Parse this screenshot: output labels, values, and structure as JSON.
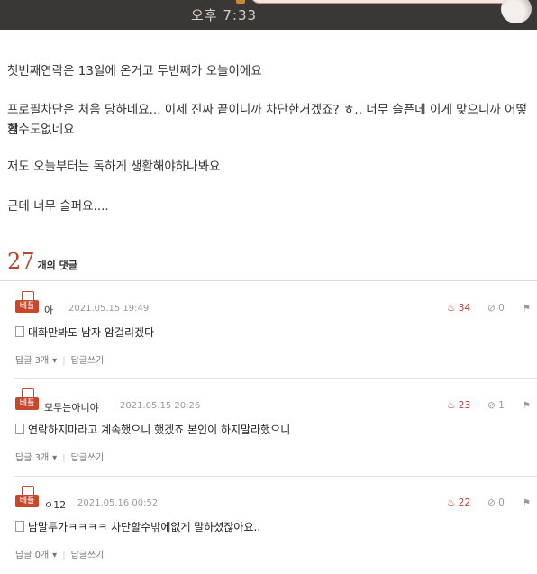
{
  "status": {
    "time": "오후 7:33"
  },
  "post": {
    "lines": [
      "첫번째연락은 13일에 온거고 두번째가 오늘이에요",
      "프로필차단은 처음 당하네요... 이제 진짜 끝이니까 차단한거겠죠? ㅎ.. 너무 슬픈데 이게 맞으니까 어떻게",
      "할수도없네요",
      "저도 오늘부터는 독하게 생활해야하나봐요",
      "근데 너무 슬퍼요...."
    ]
  },
  "comments_header": {
    "count": "27",
    "label": "개의 댓글"
  },
  "comments": [
    {
      "badge": "베플",
      "user": "아",
      "date": "2021.05.15 19:49",
      "likes": "34",
      "dislikes": "0",
      "text": "대화만봐도 남자 암걸리겠다",
      "reply_count": "답글 3개",
      "write_reply": "답글쓰기"
    },
    {
      "badge": "베플",
      "user": "모두는아니야",
      "date": "2021.05.15 20:26",
      "likes": "23",
      "dislikes": "1",
      "text": "연락하지마라고 계속했으니 했겠죠 본인이 하지말라했으니",
      "reply_count": "답글 3개",
      "write_reply": "답글쓰기"
    },
    {
      "badge": "베플",
      "user": "ㅇ12",
      "date": "2021.05.16 00:52",
      "likes": "22",
      "dislikes": "0",
      "text": "남말투가ㅋㅋㅋㅋ 차단할수밖에없게 말하셨잖아요..",
      "reply_count": "답글 0개",
      "write_reply": "답글쓰기"
    }
  ]
}
